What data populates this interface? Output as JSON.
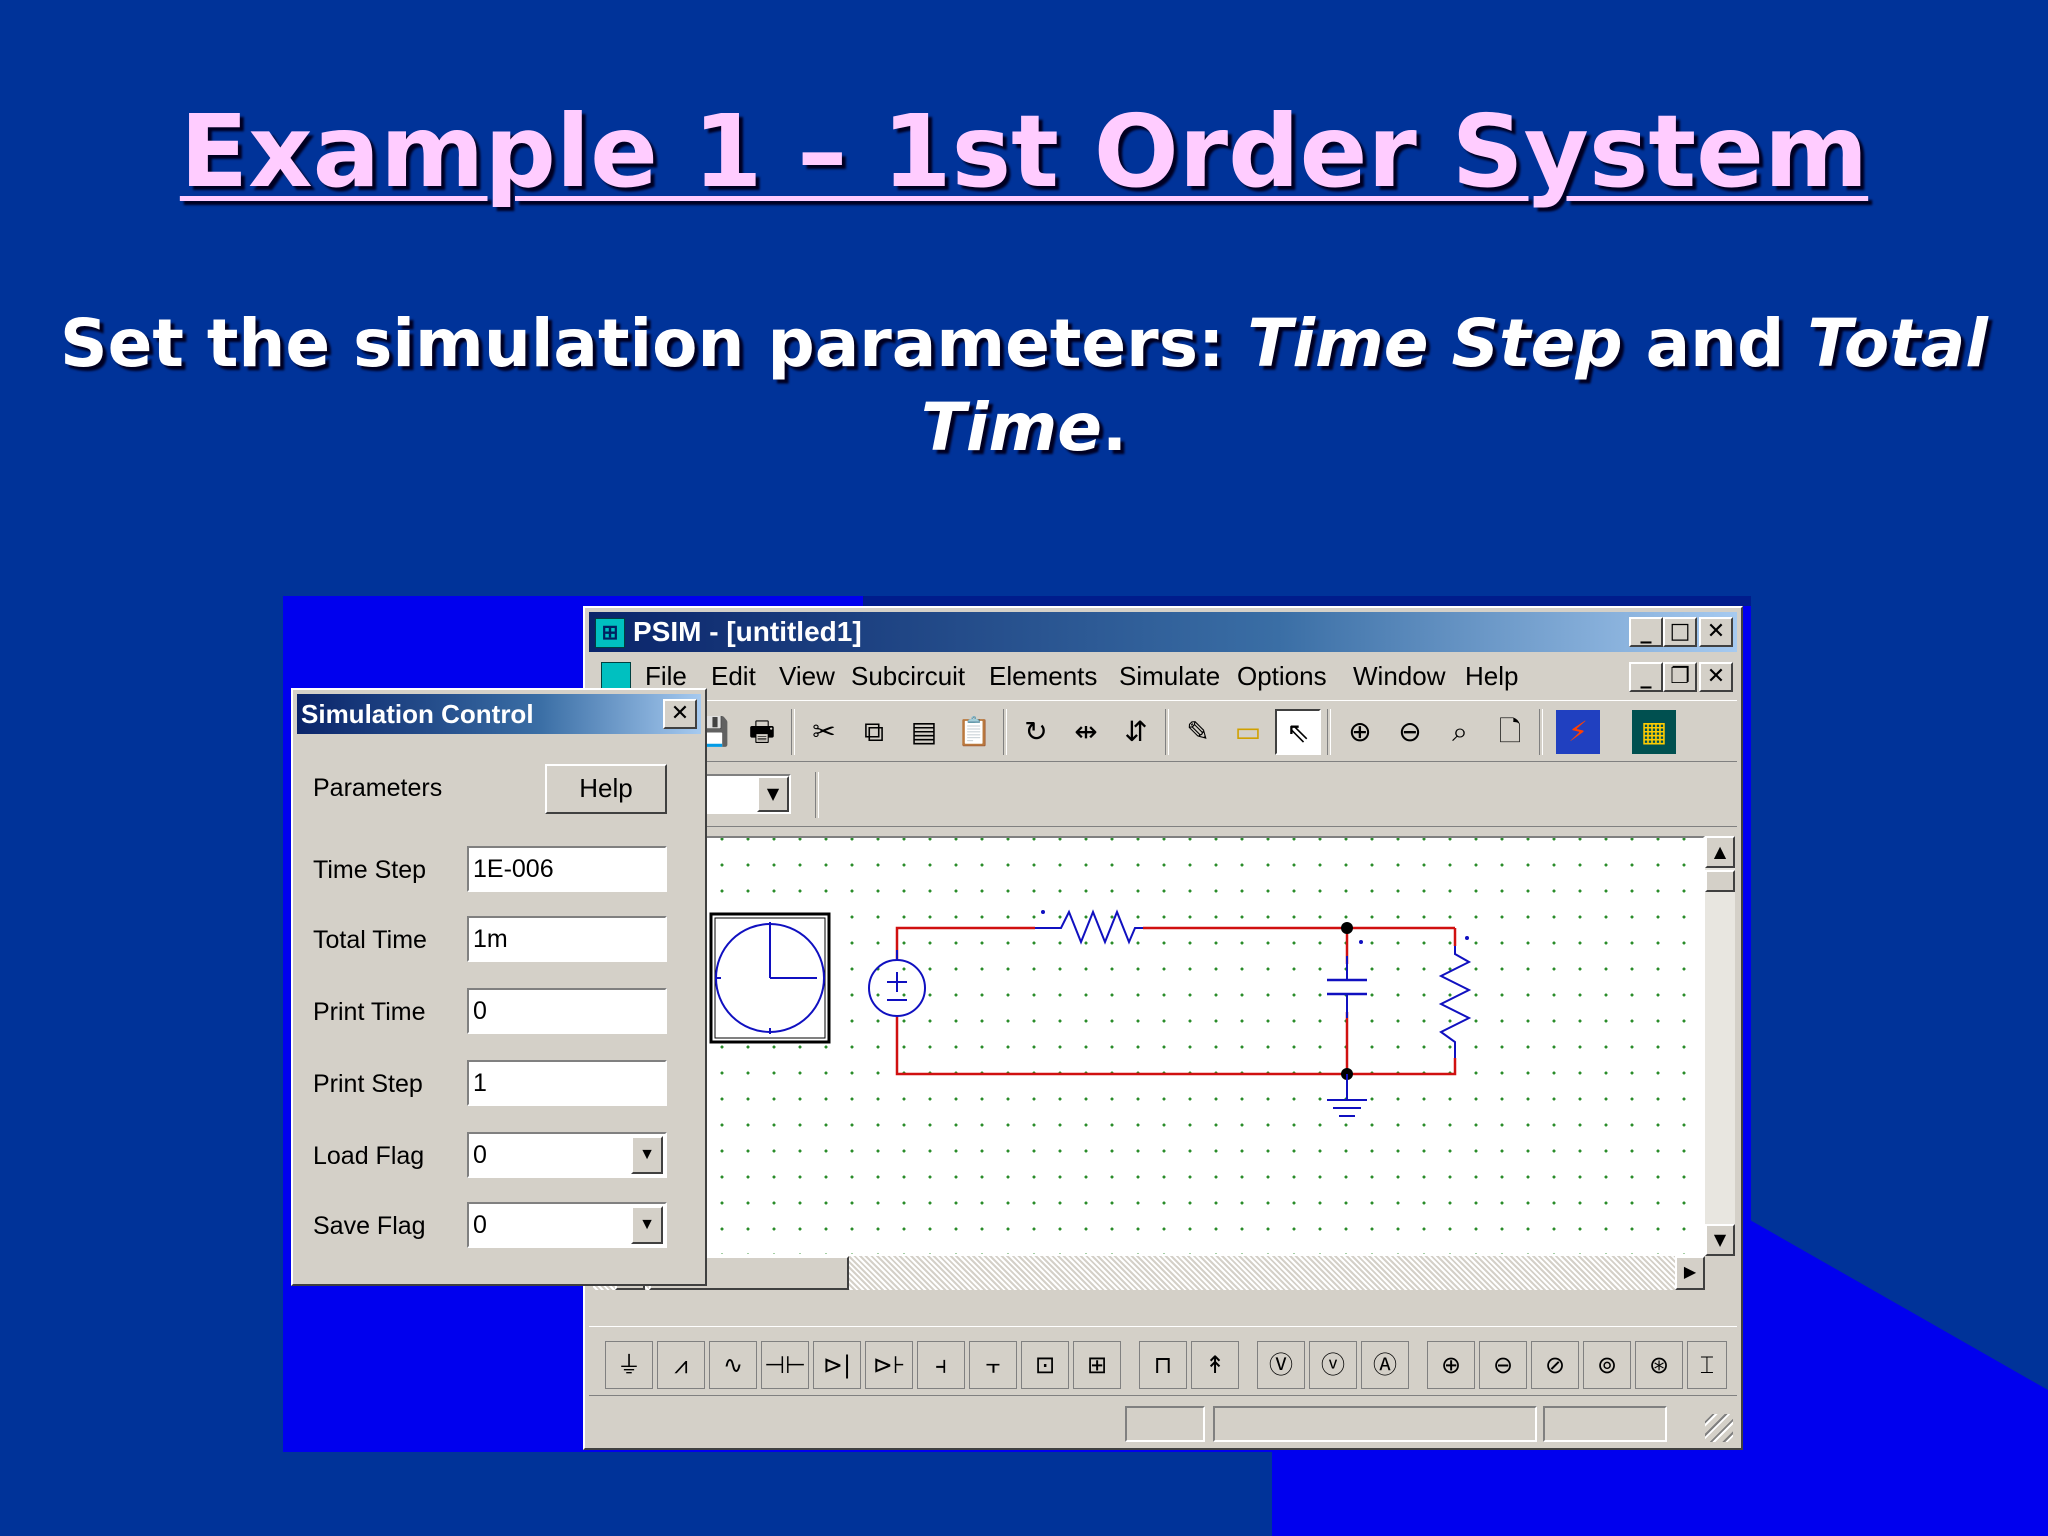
{
  "slide": {
    "title": "Example 1 – 1st Order System",
    "subtitle": {
      "part1": "Set the simulation parameters: ",
      "em1": "Time Step",
      "part2": " and ",
      "em2": "Total Time",
      "part3": "."
    }
  },
  "psim_window": {
    "title": "PSIM - [untitled1]",
    "menu": [
      "File",
      "Edit",
      "View",
      "Subcircuit",
      "Elements",
      "Simulate",
      "Options",
      "Window",
      "Help"
    ],
    "icons": {
      "toolbar": [
        "save-icon",
        "print-icon",
        "cut-icon",
        "copy-icon",
        "paste-icon",
        "clipboard-icon",
        "rotate-icon",
        "flip-lr-icon",
        "flip-tb-icon",
        "wire-pencil-icon",
        "label-icon",
        "select-arrow-icon",
        "zoom-in-icon",
        "zoom-out-icon",
        "zoom-fit-icon",
        "page-icon",
        "simulate-icon",
        "simview-icon"
      ],
      "elements": [
        "ground-icon",
        "resistor-icon",
        "inductor-icon",
        "capacitor-icon",
        "diode-icon",
        "thyristor-icon",
        "igbt-icon",
        "mosfet-icon",
        "switch-icon",
        "gto-icon",
        "block-icon",
        "probe-icon",
        "voltmeter-icon",
        "voltage-probe-icon",
        "ammeter-icon",
        "dc-source-icon",
        "ac-source-icon",
        "ac-source-2-icon",
        "current-source-icon",
        "phase-source-icon",
        "extra-icon"
      ]
    }
  },
  "sim_control": {
    "title": "Simulation Control",
    "section_label": "Parameters",
    "help_label": "Help",
    "fields": [
      {
        "label": "Time Step",
        "value": "1E-006"
      },
      {
        "label": "Total Time",
        "value": "1m"
      },
      {
        "label": "Print Time",
        "value": "0"
      },
      {
        "label": "Print Step",
        "value": "1"
      },
      {
        "label": "Load Flag",
        "value": "0"
      },
      {
        "label": "Save Flag",
        "value": "0"
      }
    ]
  },
  "colors": {
    "slide_background": "#003399",
    "title_color": "#ffccff",
    "wire_red": "#d01010",
    "component_blue": "#1010c0",
    "grid_green": "#2a8c2a"
  }
}
